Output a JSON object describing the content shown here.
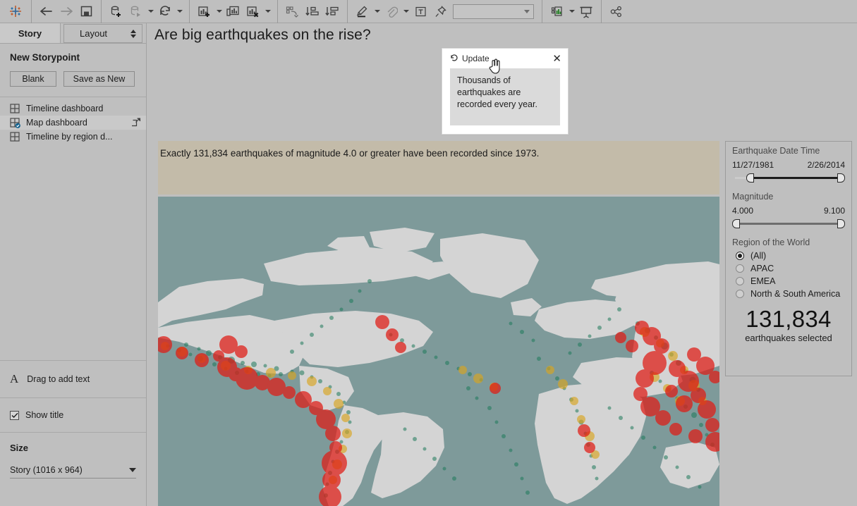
{
  "toolbar": {
    "logo_icon": "tableau-logo-icon",
    "buttons": [
      {
        "name": "back-button",
        "icon": "arrow-left-icon",
        "label": "Back"
      },
      {
        "name": "forward-button",
        "icon": "arrow-right-icon",
        "label": "Forward"
      },
      {
        "name": "save-button",
        "icon": "save-floppy-icon",
        "label": "Save"
      },
      {
        "name": "new-data-source-button",
        "icon": "database-plus-icon",
        "label": "New Data Source"
      },
      {
        "name": "pause-auto-updates-button",
        "icon": "database-play-icon",
        "label": "Pause Auto Updates"
      },
      {
        "name": "refresh-data-source-button",
        "icon": "refresh-icon",
        "label": "Refresh Data Source"
      },
      {
        "name": "new-worksheet-button",
        "icon": "chart-plus-icon",
        "label": "New Worksheet"
      },
      {
        "name": "duplicate-sheet-button",
        "icon": "chart-duplicate-icon",
        "label": "Duplicate Sheet"
      },
      {
        "name": "clear-sheet-button",
        "icon": "chart-clear-icon",
        "label": "Clear Sheet"
      },
      {
        "name": "swap-rows-columns-button",
        "icon": "swap-axes-icon",
        "label": "Swap Rows and Columns"
      },
      {
        "name": "sort-ascending-button",
        "icon": "sort-ascending-icon",
        "label": "Sort Ascending"
      },
      {
        "name": "sort-descending-button",
        "icon": "sort-descending-icon",
        "label": "Sort Descending"
      },
      {
        "name": "highlight-button",
        "icon": "highlighter-icon",
        "label": "Highlight"
      },
      {
        "name": "attach-button",
        "icon": "paperclip-icon",
        "label": "Attach"
      },
      {
        "name": "text-box-button",
        "icon": "text-box-icon",
        "label": "Text Box"
      },
      {
        "name": "fix-axis-button",
        "icon": "pin-icon",
        "label": "Fix Axis"
      },
      {
        "name": "show-me-button",
        "icon": "show-me-icon",
        "label": "Show Me"
      },
      {
        "name": "presentation-mode-button",
        "icon": "presentation-icon",
        "label": "Presentation Mode"
      },
      {
        "name": "share-button",
        "icon": "share-icon",
        "label": "Share"
      }
    ],
    "combo_value": ""
  },
  "sidebar": {
    "tab_story": "Story",
    "tab_layout": "Layout",
    "new_storypoint_heading": "New Storypoint",
    "blank_button": "Blank",
    "save_as_new_button": "Save as New",
    "sheets": [
      {
        "label": "Timeline dashboard",
        "selected": false
      },
      {
        "label": "Map dashboard",
        "selected": true
      },
      {
        "label": "Timeline by region d...",
        "selected": false
      }
    ],
    "drag_to_add_text": "Drag to add text",
    "show_title_label": "Show title",
    "show_title_checked": true,
    "size_heading": "Size",
    "size_value": "Story (1016 x 964)"
  },
  "story": {
    "title": "Are big earthquakes on the rise?",
    "caption": {
      "update_label": "Update",
      "close_label": "✕",
      "text": "Thousands of earthquakes are recorded every year."
    }
  },
  "dashboard": {
    "banner_text": "Exactly 131,834 earthquakes of magnitude 4.0 or greater have been recorded since 1973.",
    "filters": {
      "date_title": "Earthquake Date Time",
      "date_min": "11/27/1981",
      "date_max": "2/26/2014",
      "magnitude_title": "Magnitude",
      "magnitude_min": "4.000",
      "magnitude_max": "9.100",
      "region_title": "Region of the World",
      "regions": [
        {
          "label": "(All)",
          "selected": true
        },
        {
          "label": "APAC",
          "selected": false
        },
        {
          "label": "EMEA",
          "selected": false
        },
        {
          "label": "North & South America",
          "selected": false
        }
      ]
    },
    "kpi": {
      "value": "131,834",
      "caption": "earthquakes selected"
    }
  },
  "colors": {
    "chrome": "#bfbfbf",
    "banner_bg": "#c3bba9",
    "ocean": "#7e9a9a",
    "land": "#d4d4d4",
    "marker_low": "#1f7a5c",
    "marker_mid": "#d9a520",
    "marker_high": "#e01b14"
  }
}
